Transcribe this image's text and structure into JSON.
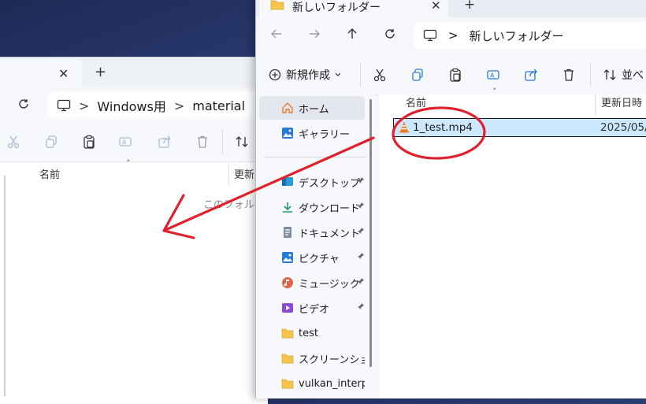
{
  "back_window": {
    "tab_close": "✕",
    "new_tab": "+",
    "breadcrumb": [
      "Windows用",
      "material"
    ],
    "breadcrumb_sep": ">",
    "column_name": "名前",
    "column_date": "更新",
    "empty_text": "このフォルダ"
  },
  "front_window": {
    "tab_title": "新しいフォルダー",
    "tab_close": "✕",
    "new_tab": "+",
    "breadcrumb_sep": ">",
    "breadcrumb": [
      "新しいフォルダー"
    ],
    "toolbar": {
      "new_label": "新規作成",
      "sort_label": "並べ"
    },
    "nav_pane": [
      {
        "label": "ホーム",
        "icon": "home-icon",
        "pinned": false
      },
      {
        "label": "ギャラリー",
        "icon": "gallery-icon",
        "pinned": false
      },
      {
        "label": "デスクトップ",
        "icon": "desktop-icon",
        "pinned": true
      },
      {
        "label": "ダウンロード",
        "icon": "download-icon",
        "pinned": true
      },
      {
        "label": "ドキュメント",
        "icon": "document-icon",
        "pinned": true
      },
      {
        "label": "ピクチャ",
        "icon": "picture-icon",
        "pinned": true
      },
      {
        "label": "ミュージック",
        "icon": "music-icon",
        "pinned": true
      },
      {
        "label": "ビデオ",
        "icon": "video-icon",
        "pinned": true
      },
      {
        "label": "test",
        "icon": "folder-icon",
        "pinned": false
      },
      {
        "label": "スクリーンショッ",
        "icon": "folder-icon",
        "pinned": false
      },
      {
        "label": "vulkan_interp",
        "icon": "folder-icon",
        "pinned": false
      }
    ],
    "column_name": "名前",
    "column_date": "更新日時",
    "files": [
      {
        "name": "1_test.mp4",
        "date": "2025/05/",
        "icon": "vlc-cone-icon",
        "selected": true
      }
    ]
  },
  "colors": {
    "selection": "#cce8ff",
    "annotation_red": "#e0202a",
    "folder_yellow": "#f4c64e",
    "accent_blue": "#2b7bd6"
  }
}
